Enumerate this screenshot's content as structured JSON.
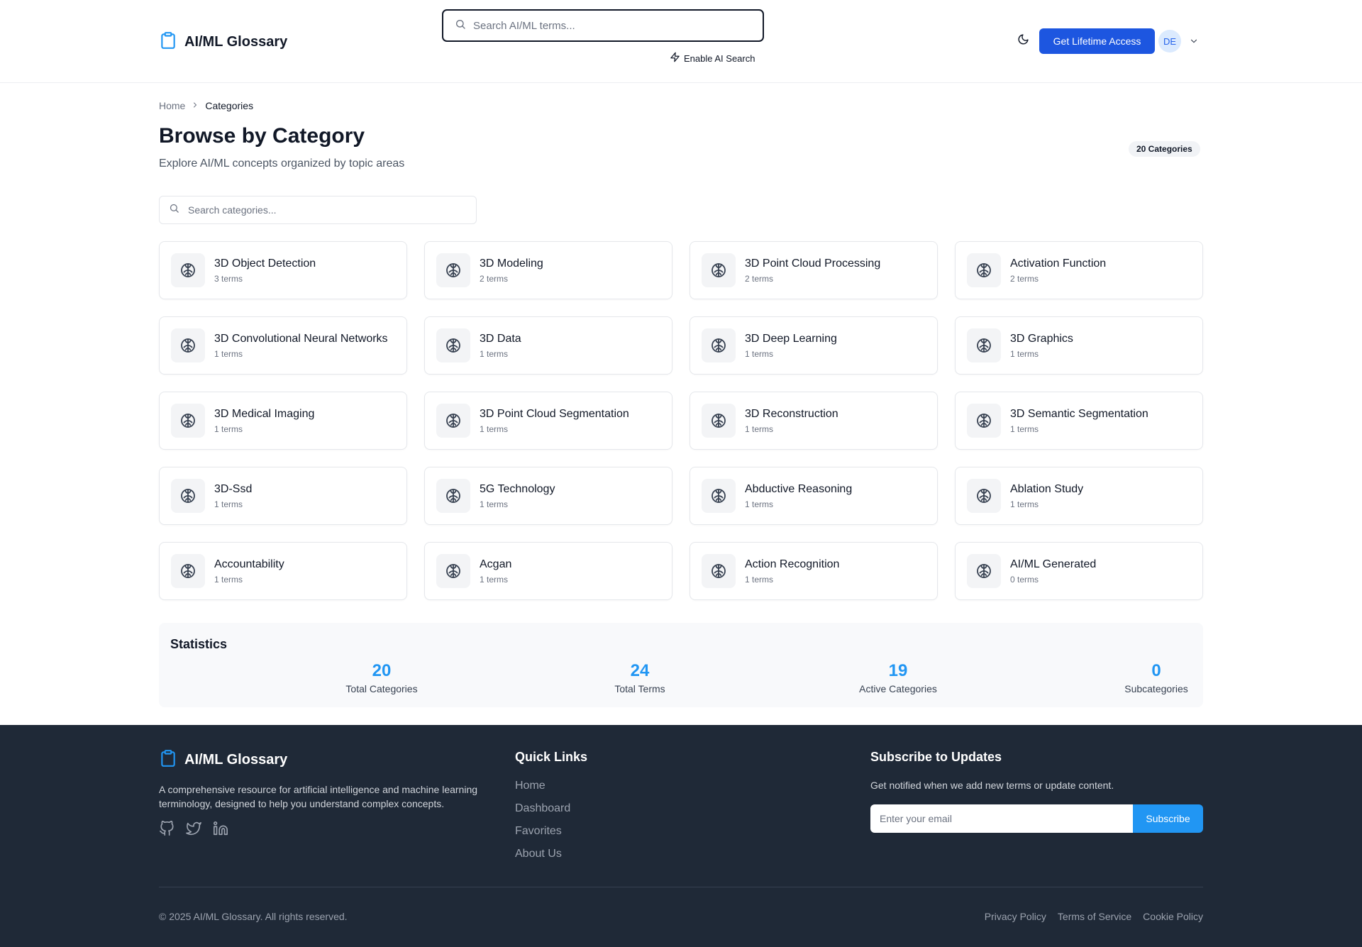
{
  "brand": {
    "name": "AI/ML Glossary",
    "logo_icon": "clipboard-icon",
    "accent_color": "#1d56e0",
    "link_color": "#2196f3"
  },
  "header": {
    "search_placeholder": "Search AI/ML terms...",
    "ai_search_label": "Enable AI Search",
    "theme_icon": "moon-icon",
    "cta_label": "Get Lifetime Access",
    "avatar_initials": "DE"
  },
  "breadcrumb": {
    "home": "Home",
    "current": "Categories"
  },
  "page": {
    "title": "Browse by Category",
    "subtitle": "Explore AI/ML concepts organized by topic areas",
    "count_badge": "20 Categories",
    "category_search_placeholder": "Search categories..."
  },
  "categories": [
    {
      "name": "3D Object Detection",
      "count": "3 terms",
      "icon": "brain-icon"
    },
    {
      "name": "3D Modeling",
      "count": "2 terms",
      "icon": "brain-icon"
    },
    {
      "name": "3D Point Cloud Processing",
      "count": "2 terms",
      "icon": "brain-icon"
    },
    {
      "name": "Activation Function",
      "count": "2 terms",
      "icon": "brain-icon"
    },
    {
      "name": "3D Convolutional Neural Networks",
      "count": "1 terms",
      "icon": "brain-icon"
    },
    {
      "name": "3D Data",
      "count": "1 terms",
      "icon": "brain-icon"
    },
    {
      "name": "3D Deep Learning",
      "count": "1 terms",
      "icon": "brain-icon"
    },
    {
      "name": "3D Graphics",
      "count": "1 terms",
      "icon": "brain-icon"
    },
    {
      "name": "3D Medical Imaging",
      "count": "1 terms",
      "icon": "brain-icon"
    },
    {
      "name": "3D Point Cloud Segmentation",
      "count": "1 terms",
      "icon": "brain-icon"
    },
    {
      "name": "3D Reconstruction",
      "count": "1 terms",
      "icon": "brain-icon"
    },
    {
      "name": "3D Semantic Segmentation",
      "count": "1 terms",
      "icon": "brain-icon"
    },
    {
      "name": "3D-Ssd",
      "count": "1 terms",
      "icon": "brain-icon"
    },
    {
      "name": "5G Technology",
      "count": "1 terms",
      "icon": "brain-icon"
    },
    {
      "name": "Abductive Reasoning",
      "count": "1 terms",
      "icon": "brain-icon"
    },
    {
      "name": "Ablation Study",
      "count": "1 terms",
      "icon": "brain-icon"
    },
    {
      "name": "Accountability",
      "count": "1 terms",
      "icon": "brain-icon"
    },
    {
      "name": "Acgan",
      "count": "1 terms",
      "icon": "brain-icon"
    },
    {
      "name": "Action Recognition",
      "count": "1 terms",
      "icon": "brain-icon"
    },
    {
      "name": "AI/ML Generated",
      "count": "0 terms",
      "icon": "brain-icon"
    }
  ],
  "stats": {
    "title": "Statistics",
    "items": [
      {
        "value": "20",
        "label": "Total Categories"
      },
      {
        "value": "24",
        "label": "Total Terms"
      },
      {
        "value": "19",
        "label": "Active Categories"
      },
      {
        "value": "0",
        "label": "Subcategories"
      }
    ]
  },
  "footer": {
    "brand": "AI/ML Glossary",
    "description": "A comprehensive resource for artificial intelligence and machine learning terminology, designed to help you understand complex concepts.",
    "social_icons": [
      "github-icon",
      "twitter-icon",
      "linkedin-icon"
    ],
    "quick_links_heading": "Quick Links",
    "quick_links": [
      "Home",
      "Dashboard",
      "Favorites",
      "About Us"
    ],
    "subscribe_heading": "Subscribe to Updates",
    "subscribe_text": "Get notified when we add new terms or update content.",
    "email_placeholder": "Enter your email",
    "subscribe_label": "Subscribe",
    "copyright": "© 2025 AI/ML Glossary. All rights reserved.",
    "legal_links": [
      "Privacy Policy",
      "Terms of Service",
      "Cookie Policy"
    ]
  }
}
